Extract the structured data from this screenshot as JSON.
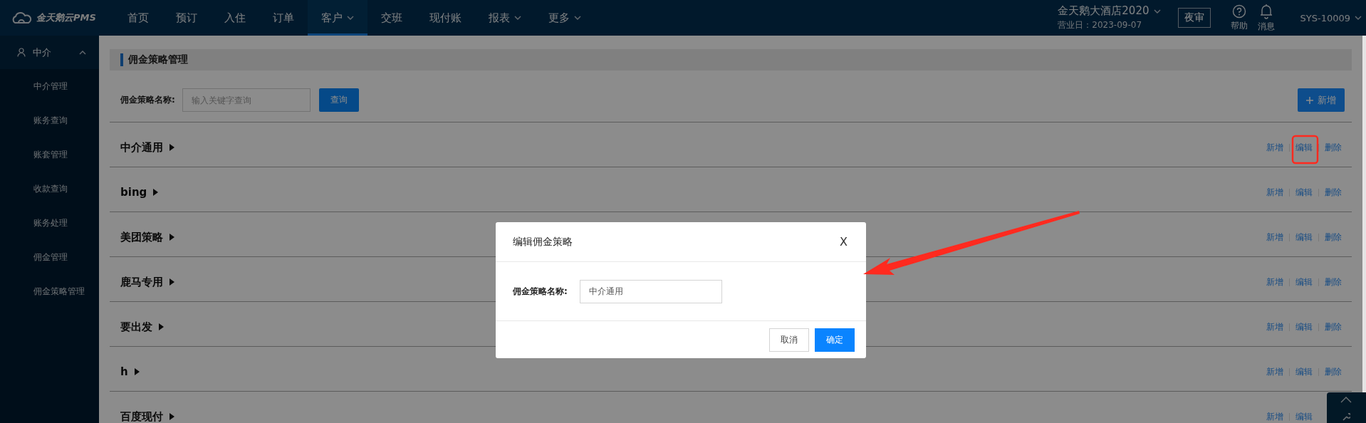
{
  "header": {
    "logo_text": "金天鹅云PMS",
    "nav": [
      {
        "label": "首页",
        "selected": false,
        "dropdown": false
      },
      {
        "label": "预订",
        "selected": false,
        "dropdown": false
      },
      {
        "label": "入住",
        "selected": false,
        "dropdown": false
      },
      {
        "label": "订单",
        "selected": false,
        "dropdown": false
      },
      {
        "label": "客户",
        "selected": true,
        "dropdown": true
      },
      {
        "label": "交班",
        "selected": false,
        "dropdown": false
      },
      {
        "label": "现付账",
        "selected": false,
        "dropdown": false
      },
      {
        "label": "报表",
        "selected": false,
        "dropdown": true
      },
      {
        "label": "更多",
        "selected": false,
        "dropdown": true
      }
    ],
    "hotel": "金天鹅大酒店2020",
    "business_date": "营业日：2023-09-07",
    "night_audit": "夜审",
    "help": "帮助",
    "messages": "消息",
    "user": "SYS-10009"
  },
  "sidebar": {
    "group": {
      "label": "中介",
      "expanded": true
    },
    "items": [
      {
        "label": "中介管理",
        "selected": false
      },
      {
        "label": "账务查询",
        "selected": false
      },
      {
        "label": "账套管理",
        "selected": false
      },
      {
        "label": "收款查询",
        "selected": false
      },
      {
        "label": "账务处理",
        "selected": false
      },
      {
        "label": "佣金管理",
        "selected": false
      },
      {
        "label": "佣金策略管理",
        "selected": false
      }
    ]
  },
  "page": {
    "title": "佣金策略管理",
    "search_label": "佣金策略名称:",
    "search_placeholder": "输入关键字查询",
    "search_button": "查询",
    "add_button": "新增",
    "rows": [
      {
        "name": "中介通用",
        "actions": [
          "新增",
          "编辑",
          "删除"
        ]
      },
      {
        "name": "bing",
        "actions": [
          "新增",
          "编辑",
          "删除"
        ]
      },
      {
        "name": "美团策略",
        "actions": [
          "新增",
          "编辑",
          "删除"
        ]
      },
      {
        "name": "鹿马专用",
        "actions": [
          "新增",
          "编辑",
          "删除"
        ]
      },
      {
        "name": "要出发",
        "actions": [
          "新增",
          "编辑",
          "删除"
        ]
      },
      {
        "name": "h",
        "actions": [
          "新增",
          "编辑",
          "删除"
        ]
      },
      {
        "name": "百度现付",
        "actions": [
          "新增",
          "编辑"
        ]
      }
    ]
  },
  "dialog": {
    "title": "编辑佣金策略",
    "close": "X",
    "field_label": "佣金策略名称:",
    "field_value": "中介通用",
    "cancel": "取消",
    "confirm": "确定"
  }
}
